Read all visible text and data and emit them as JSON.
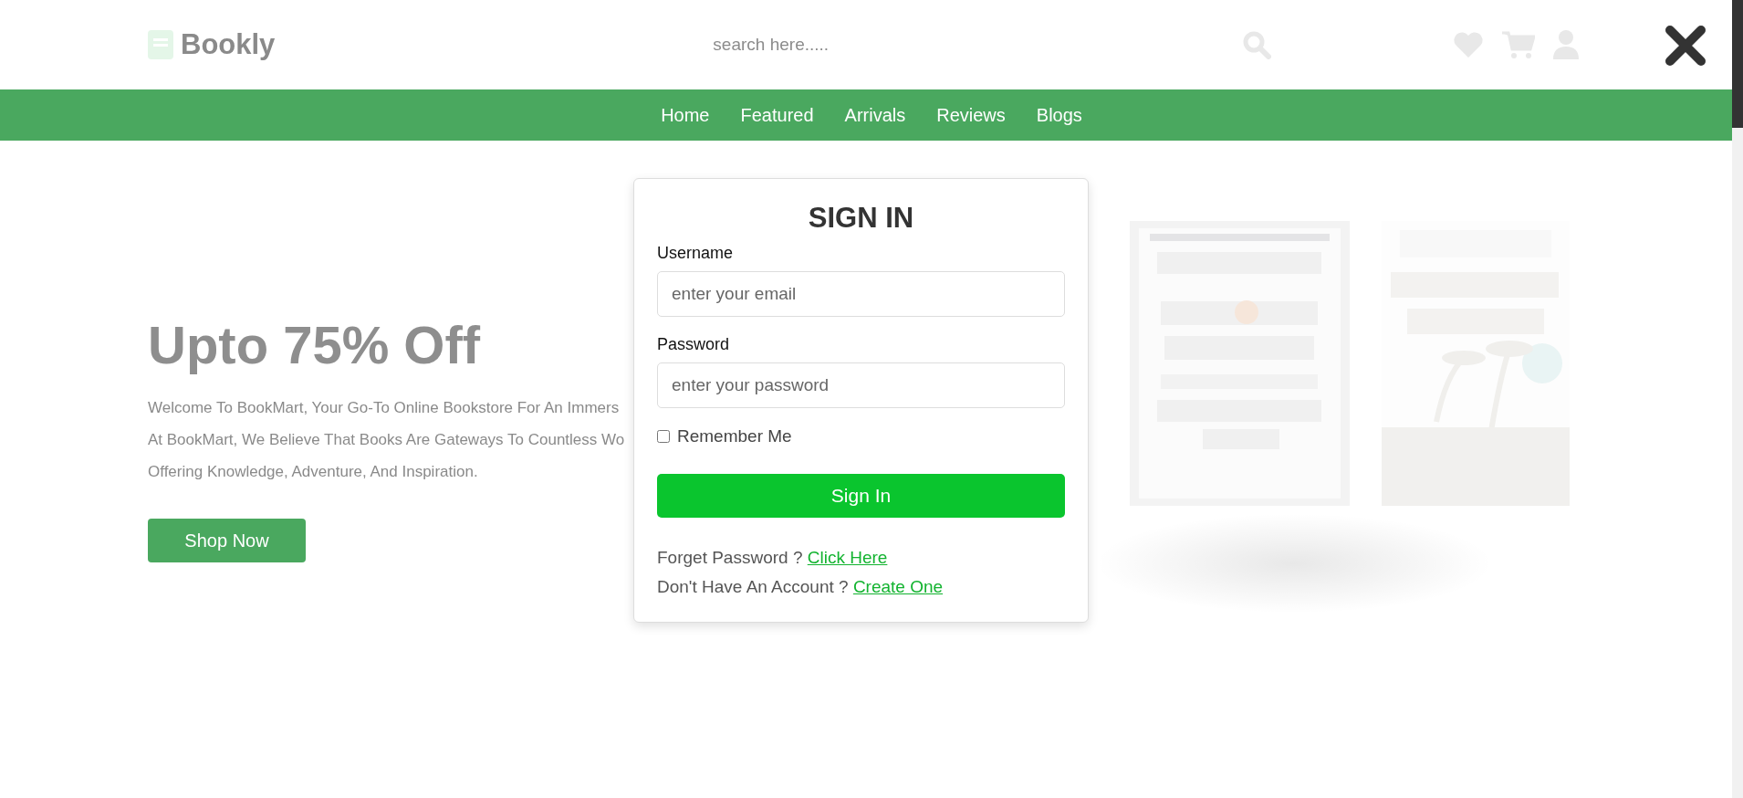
{
  "header": {
    "logo": "Bookly",
    "search": {
      "placeholder": "search here....."
    }
  },
  "nav": [
    "Home",
    "Featured",
    "Arrivals",
    "Reviews",
    "Blogs"
  ],
  "hero": {
    "heading": "Upto 75% Off",
    "lines": [
      "Welcome To BookMart, Your Go-To Online Bookstore For An Immers",
      "At BookMart, We Believe That Books Are Gateways To Countless Wo",
      "Offering Knowledge, Adventure, And Inspiration."
    ],
    "button": "Shop Now"
  },
  "modal": {
    "title": "SIGN IN",
    "fields": [
      {
        "label": "Username",
        "placeholder": "enter your email"
      },
      {
        "label": "Password",
        "placeholder": "enter your password"
      }
    ],
    "remember": {
      "label": "Remember Me",
      "checked": false
    },
    "submit": "Sign In",
    "links": [
      {
        "text": "Forget Password ?",
        "link": "Click Here"
      },
      {
        "text": "Don't Have An Account ?",
        "link": "Create One"
      }
    ]
  }
}
